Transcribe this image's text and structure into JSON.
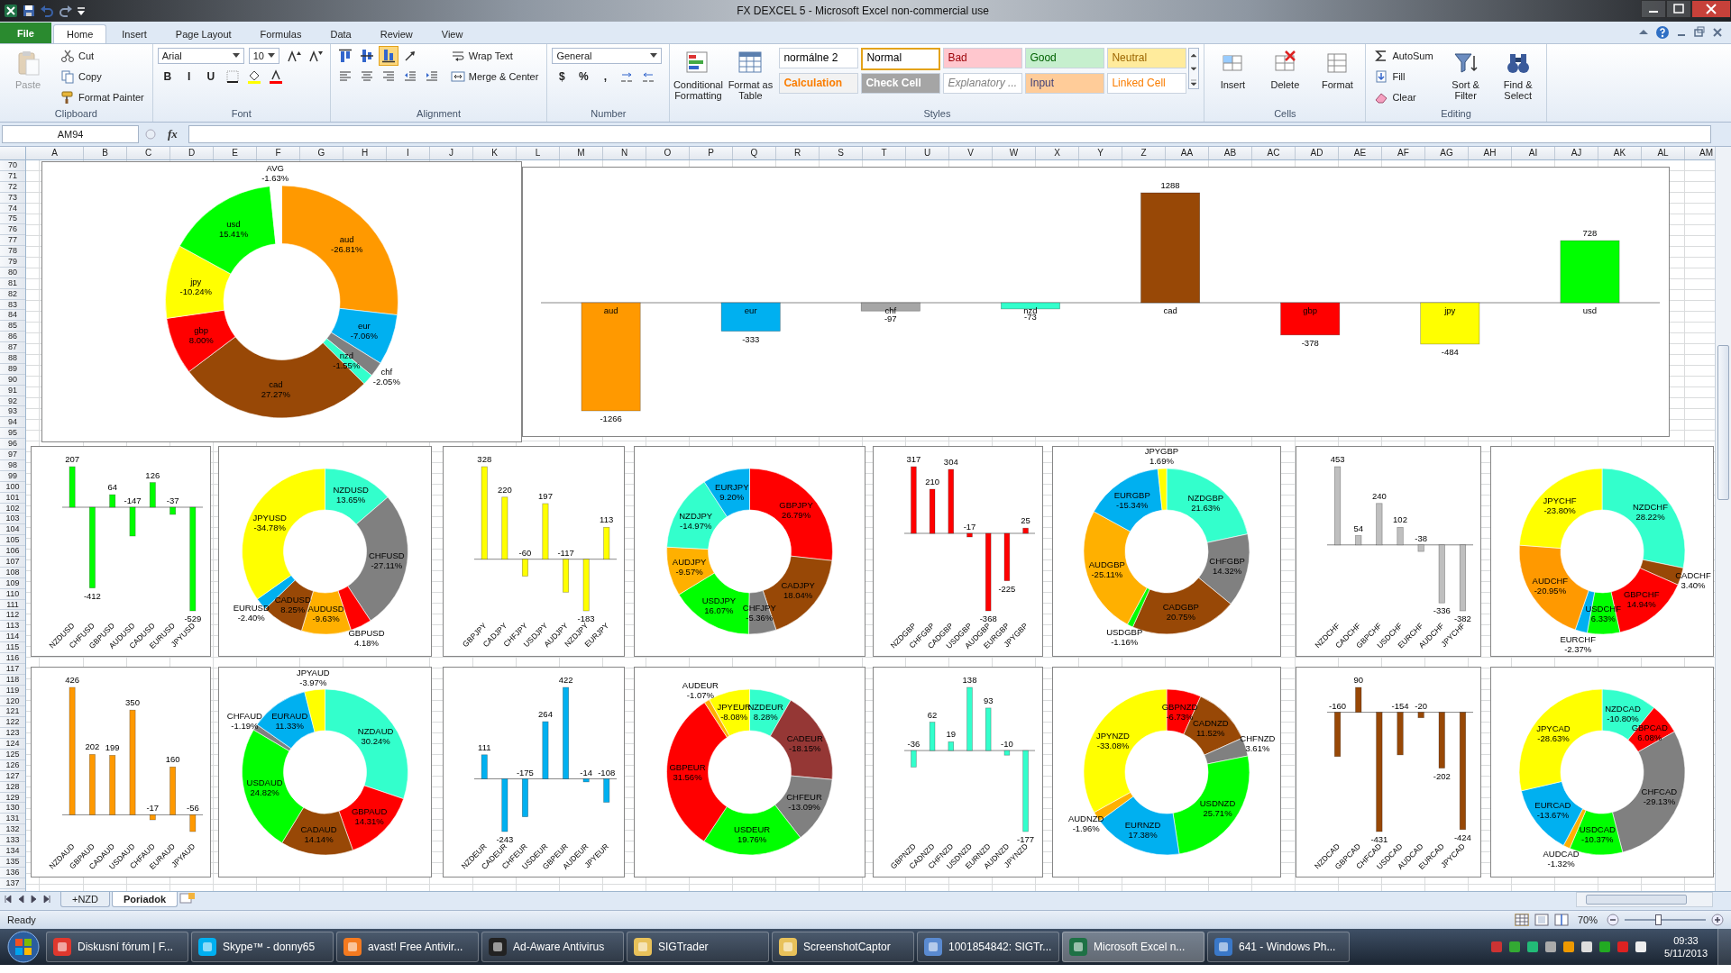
{
  "title_bar": {
    "title": "FX DEXCEL 5 - Microsoft Excel non-commercial use"
  },
  "ribbon_tabs": [
    {
      "label": "File",
      "kind": "file",
      "selected": false
    },
    {
      "label": "Home",
      "kind": "tab",
      "selected": true
    },
    {
      "label": "Insert",
      "kind": "tab",
      "selected": false
    },
    {
      "label": "Page Layout",
      "kind": "tab",
      "selected": false
    },
    {
      "label": "Formulas",
      "kind": "tab",
      "selected": false
    },
    {
      "label": "Data",
      "kind": "tab",
      "selected": false
    },
    {
      "label": "Review",
      "kind": "tab",
      "selected": false
    },
    {
      "label": "View",
      "kind": "tab",
      "selected": false
    }
  ],
  "ribbon": {
    "groups": [
      {
        "label": "Clipboard",
        "stacks": [
          [
            [
              {
                "kind": "large",
                "label": "Paste",
                "disabled": true
              }
            ]
          ],
          [
            [
              {
                "kind": "small",
                "label": "Cut",
                "disabled": false
              }
            ],
            [
              {
                "kind": "small",
                "label": "Copy",
                "disabled": false
              }
            ],
            [
              {
                "kind": "small",
                "label": "Format Painter",
                "disabled": false
              }
            ]
          ]
        ]
      },
      {
        "label": "Font",
        "stacks": [
          [
            [
              {
                "kind": "combo",
                "value": "Arial"
              },
              {
                "kind": "combo",
                "value": "10"
              },
              {
                "kind": "icon"
              },
              {
                "kind": "icon"
              }
            ],
            [
              {
                "kind": "text",
                "label": "B"
              },
              {
                "kind": "text",
                "label": "I"
              },
              {
                "kind": "text",
                "label": "U"
              },
              {
                "kind": "icon"
              },
              {
                "kind": "icon"
              },
              {
                "kind": "icon"
              }
            ]
          ]
        ]
      },
      {
        "label": "Alignment",
        "stacks": [
          [
            [
              {
                "kind": "icon",
                "selected": false
              },
              {
                "kind": "icon",
                "selected": false
              },
              {
                "kind": "icon",
                "selected": true
              },
              {
                "kind": "icon",
                "selected": false
              }
            ],
            [
              {
                "kind": "icon"
              },
              {
                "kind": "icon"
              },
              {
                "kind": "icon"
              },
              {
                "kind": "icon"
              },
              {
                "kind": "icon"
              }
            ]
          ],
          [
            [
              {
                "kind": "small",
                "label": "Wrap Text"
              }
            ],
            [
              {
                "kind": "small",
                "label": "Merge & Center"
              }
            ]
          ]
        ]
      },
      {
        "label": "Number",
        "stacks": [
          [
            [
              {
                "kind": "combo",
                "value": "General"
              }
            ],
            [
              {
                "kind": "text",
                "label": "$"
              },
              {
                "kind": "text",
                "label": "%"
              },
              {
                "kind": "text",
                "label": ","
              },
              {
                "kind": "icon"
              },
              {
                "kind": "icon"
              }
            ]
          ]
        ]
      },
      {
        "label": "Styles",
        "stacks": [
          [
            [
              {
                "kind": "large",
                "label": "Conditional Formatting"
              }
            ]
          ],
          [
            [
              {
                "kind": "large",
                "label": "Format as Table"
              }
            ]
          ],
          [
            [
              {
                "kind": "gallery",
                "styles": [
                  {
                    "label": "normálne 2",
                    "color": "#ffffff",
                    "kind": "normal",
                    "selected": false
                  },
                  {
                    "label": "Normal",
                    "color": "#ffffff",
                    "kind": "normal",
                    "selected": true
                  },
                  {
                    "label": "Bad",
                    "color": "#ffc7ce",
                    "kind": "bad",
                    "selected": false
                  },
                  {
                    "label": "Good",
                    "color": "#c6efce",
                    "kind": "good",
                    "selected": false
                  },
                  {
                    "label": "Neutral",
                    "color": "#ffeb9c",
                    "kind": "neutral",
                    "selected": false
                  },
                  {
                    "label": "Calculation",
                    "color": "#f2f2f2",
                    "kind": "calculation",
                    "selected": false
                  },
                  {
                    "label": "Check Cell",
                    "color": "#a5a5a5",
                    "kind": "check",
                    "selected": false
                  },
                  {
                    "label": "Explanatory ...",
                    "color": "#ffffff",
                    "kind": "explanatory",
                    "selected": false
                  },
                  {
                    "label": "Input",
                    "color": "#ffcc99",
                    "kind": "input",
                    "selected": false
                  },
                  {
                    "label": "Linked Cell",
                    "color": "#ffffff",
                    "kind": "linked",
                    "selected": false
                  }
                ]
              }
            ]
          ]
        ]
      },
      {
        "label": "Cells",
        "stacks": [
          [
            [
              {
                "kind": "large",
                "label": "Insert"
              }
            ]
          ],
          [
            [
              {
                "kind": "large",
                "label": "Delete"
              }
            ]
          ],
          [
            [
              {
                "kind": "large",
                "label": "Format"
              }
            ]
          ]
        ]
      },
      {
        "label": "Editing",
        "stacks": [
          [
            [
              {
                "kind": "small",
                "label": "AutoSum"
              }
            ],
            [
              {
                "kind": "small",
                "label": "Fill"
              }
            ],
            [
              {
                "kind": "small",
                "label": "Clear"
              }
            ]
          ],
          [
            [
              {
                "kind": "large",
                "label": "Sort & Filter"
              }
            ]
          ],
          [
            [
              {
                "kind": "large",
                "label": "Find & Select"
              }
            ]
          ]
        ]
      }
    ]
  },
  "formula_bar": {
    "name_box": "AM94",
    "function_label": "fx"
  },
  "sheet": {
    "columns": [
      "A",
      "B",
      "C",
      "D",
      "E",
      "F",
      "G",
      "H",
      "I",
      "J",
      "K",
      "L",
      "M",
      "N",
      "O",
      "P",
      "Q",
      "R",
      "S",
      "T",
      "U",
      "V",
      "W",
      "X",
      "Y",
      "Z",
      "AA",
      "AB",
      "AC",
      "AD",
      "AE",
      "AF",
      "AG",
      "AH",
      "AI",
      "AJ",
      "AK",
      "AL",
      "AM"
    ],
    "rows": [
      "70",
      "71",
      "72",
      "73",
      "74",
      "75",
      "76",
      "77",
      "78",
      "79",
      "80",
      "81",
      "82",
      "83",
      "84",
      "85",
      "86",
      "87",
      "88",
      "89",
      "90",
      "91",
      "92",
      "93",
      "94",
      "95",
      "96",
      "97",
      "98",
      "99",
      "100",
      "101",
      "102",
      "103",
      "104",
      "105",
      "106",
      "107",
      "108",
      "109",
      "110",
      "111",
      "112",
      "113",
      "114",
      "115",
      "116",
      "117",
      "118",
      "119",
      "120",
      "121",
      "122",
      "123",
      "124",
      "125",
      "126",
      "127",
      "128",
      "129",
      "130",
      "131",
      "132",
      "133",
      "134",
      "135",
      "136",
      "137"
    ]
  },
  "charts": [
    {
      "chart_data": {
        "type": "donut",
        "categories": [
          "aud",
          "eur",
          "chf",
          "nzd",
          "cad",
          "gbp",
          "jpy",
          "usd",
          "AVG"
        ],
        "series": [
          {
            "values": [
              26.81,
              7.06,
              2.05,
              1.55,
              27.27,
              8.0,
              10.24,
              15.41,
              1.63
            ],
            "colors": [
              "#ff9900",
              "#00b0f0",
              "#808080",
              "#33ffcc",
              "#984806",
              "#ff0000",
              "#ffff00",
              "#00ff00",
              "#ffffff"
            ]
          }
        ],
        "value_labels": [
          "-26.81%",
          "-7.06%",
          "-2.05%",
          "-1.55%",
          "27.27%",
          "8.00%",
          "-10.24%",
          "15.41%",
          "-1.63%"
        ]
      }
    },
    {
      "chart_data": {
        "type": "bar",
        "categories": [
          "aud",
          "eur",
          "chf",
          "nzd",
          "cad",
          "gbp",
          "jpy",
          "usd"
        ],
        "series": [
          {
            "values": [
              -1266,
              -333,
              -97,
              -73,
              1288,
              -378,
              -484,
              728
            ],
            "colors": [
              "#ff9900",
              "#00b0f0",
              "#a6a6a6",
              "#33ffcc",
              "#984806",
              "#ff0000",
              "#ffff00",
              "#00ff00"
            ]
          }
        ],
        "data_labels": true
      }
    },
    {
      "chart_data": {
        "type": "bar",
        "categories": [
          "NZDUSD",
          "CHFUSD",
          "GBPUSD",
          "AUDUSD",
          "CADUSD",
          "EURUSD",
          "JPYUSD"
        ],
        "series": [
          {
            "color": "#00ff00",
            "values": [
              207,
              -412,
              64,
              -147,
              126,
              -37,
              -529
            ]
          }
        ],
        "data_labels": true
      }
    },
    {
      "chart_data": {
        "type": "donut",
        "categories": [
          "NZDUSD",
          "CHFUSD",
          "GBPUSD",
          "AUDUSD",
          "CADUSD",
          "EURUSD",
          "JPYUSD"
        ],
        "series": [
          {
            "values": [
              13.65,
              27.11,
              4.18,
              9.63,
              8.25,
              2.4,
              34.78
            ],
            "colors": [
              "#33ffcc",
              "#808080",
              "#ff0000",
              "#ffb000",
              "#984806",
              "#00b0f0",
              "#ffff00"
            ]
          }
        ],
        "value_labels": [
          "13.65%",
          "-27.11%",
          "4.18%",
          "-9.63%",
          "8.25%",
          "-2.40%",
          "-34.78%"
        ]
      }
    },
    {
      "chart_data": {
        "type": "bar",
        "categories": [
          "GBPJPY",
          "CADJPY",
          "CHFJPY",
          "USDJPY",
          "AUDJPY",
          "NZDJPY",
          "EURJPY"
        ],
        "series": [
          {
            "color": "#ffff00",
            "values": [
              328,
              220,
              -60,
              197,
              -117,
              -183,
              113
            ]
          }
        ],
        "data_labels": true
      }
    },
    {
      "chart_data": {
        "type": "donut",
        "categories": [
          "GBPJPY",
          "CADJPY",
          "CHFJPY",
          "USDJPY",
          "AUDJPY",
          "NZDJPY",
          "EURJPY"
        ],
        "series": [
          {
            "values": [
              26.79,
              18.04,
              5.36,
              16.07,
              9.57,
              14.97,
              9.2
            ],
            "colors": [
              "#ff0000",
              "#984806",
              "#808080",
              "#00ff00",
              "#ffb000",
              "#33ffcc",
              "#00b0f0"
            ]
          }
        ],
        "value_labels": [
          "26.79%",
          "18.04%",
          "-5.36%",
          "16.07%",
          "-9.57%",
          "-14.97%",
          "9.20%"
        ]
      }
    },
    {
      "chart_data": {
        "type": "bar",
        "categories": [
          "NZDGBP",
          "CHFGBP",
          "CADGBP",
          "USDGBP",
          "AUDGBP",
          "EURGBP",
          "JPYGBP"
        ],
        "series": [
          {
            "color": "#ff0000",
            "values": [
              317,
              210,
              304,
              -17,
              -368,
              -225,
              25
            ]
          }
        ],
        "data_labels": true
      }
    },
    {
      "chart_data": {
        "type": "donut",
        "categories": [
          "NZDGBP",
          "CHFGBP",
          "CADGBP",
          "USDGBP",
          "AUDGBP",
          "EURGBP",
          "JPYGBP"
        ],
        "series": [
          {
            "values": [
              21.63,
              14.32,
              20.75,
              1.16,
              25.11,
              15.34,
              1.69
            ],
            "colors": [
              "#33ffcc",
              "#808080",
              "#984806",
              "#00ff00",
              "#ffb000",
              "#00b0f0",
              "#ffff00"
            ]
          }
        ],
        "value_labels": [
          "21.63%",
          "14.32%",
          "20.75%",
          "-1.16%",
          "-25.11%",
          "-15.34%",
          "1.69%"
        ]
      }
    },
    {
      "chart_data": {
        "type": "bar",
        "categories": [
          "NZDCHF",
          "CADCHF",
          "GBPCHF",
          "USDCHF",
          "EURCHF",
          "AUDCHF",
          "JPYCHF"
        ],
        "series": [
          {
            "color": "#bfbfbf",
            "values": [
              453,
              54,
              240,
              102,
              -38,
              -336,
              -382
            ]
          }
        ],
        "data_labels": true
      }
    },
    {
      "chart_data": {
        "type": "donut",
        "categories": [
          "NZDCHF",
          "CADCHF",
          "GBPCHF",
          "USDCHF",
          "EURCHF",
          "AUDCHF",
          "JPYCHF"
        ],
        "series": [
          {
            "values": [
              28.22,
              3.4,
              14.94,
              6.33,
              2.37,
              20.95,
              23.8
            ],
            "colors": [
              "#33ffcc",
              "#984806",
              "#ff0000",
              "#00ff00",
              "#00b0f0",
              "#ff9900",
              "#ffff00"
            ]
          }
        ],
        "value_labels": [
          "28.22%",
          "3.40%",
          "14.94%",
          "6.33%",
          "-2.37%",
          "-20.95%",
          "-23.80%"
        ]
      }
    },
    {
      "chart_data": {
        "type": "bar",
        "categories": [
          "NZDAUD",
          "GBPAUD",
          "CADAUD",
          "USDAUD",
          "CHFAUD",
          "EURAUD",
          "JPYAUD"
        ],
        "series": [
          {
            "color": "#ff9900",
            "values": [
              426,
              202,
              199,
              350,
              -17,
              160,
              -56
            ]
          }
        ],
        "data_labels": true
      }
    },
    {
      "chart_data": {
        "type": "donut",
        "categories": [
          "NZDAUD",
          "GBPAUD",
          "CADAUD",
          "USDAUD",
          "CHFAUD",
          "EURAUD",
          "JPYAUD"
        ],
        "series": [
          {
            "values": [
              30.24,
              14.31,
              14.14,
              24.82,
              1.19,
              11.33,
              3.97
            ],
            "colors": [
              "#33ffcc",
              "#ff0000",
              "#984806",
              "#00ff00",
              "#808080",
              "#00b0f0",
              "#ffff00"
            ]
          }
        ],
        "value_labels": [
          "30.24%",
          "14.31%",
          "14.14%",
          "24.82%",
          "-1.19%",
          "11.33%",
          "-3.97%"
        ]
      }
    },
    {
      "chart_data": {
        "type": "bar",
        "categories": [
          "NZDEUR",
          "CADEUR",
          "CHFEUR",
          "USDEUR",
          "GBPEUR",
          "AUDEUR",
          "JPYEUR"
        ],
        "series": [
          {
            "color": "#00b0f0",
            "values": [
              111,
              -243,
              -175,
              264,
              422,
              -14,
              -108
            ]
          }
        ],
        "data_labels": true
      }
    },
    {
      "chart_data": {
        "type": "donut",
        "categories": [
          "NZDEUR",
          "CADEUR",
          "CHFEUR",
          "USDEUR",
          "GBPEUR",
          "AUDEUR",
          "JPYEUR"
        ],
        "series": [
          {
            "values": [
              8.28,
              18.15,
              13.09,
              19.76,
              31.56,
              1.07,
              8.08
            ],
            "colors": [
              "#33ffcc",
              "#953735",
              "#808080",
              "#00ff00",
              "#ff0000",
              "#ffb000",
              "#ffff00"
            ]
          }
        ],
        "value_labels": [
          "8.28%",
          "-18.15%",
          "-13.09%",
          "19.76%",
          "31.56%",
          "-1.07%",
          "-8.08%"
        ]
      }
    },
    {
      "chart_data": {
        "type": "bar",
        "categories": [
          "GBPNZD",
          "CADNZD",
          "CHFNZD",
          "USDNZD",
          "EURNZD",
          "AUDNZD",
          "JPYNZD"
        ],
        "series": [
          {
            "color": "#33ffcc",
            "values": [
              -36,
              62,
              19,
              138,
              93,
              -10,
              -177
            ]
          }
        ],
        "data_labels": true
      }
    },
    {
      "chart_data": {
        "type": "donut",
        "categories": [
          "GBPNZD",
          "CADNZD",
          "CHFNZD",
          "USDNZD",
          "EURNZD",
          "AUDNZD",
          "JPYNZD"
        ],
        "series": [
          {
            "values": [
              6.73,
              11.52,
              3.61,
              25.71,
              17.38,
              1.96,
              33.08
            ],
            "colors": [
              "#ff0000",
              "#984806",
              "#808080",
              "#00ff00",
              "#00b0f0",
              "#ffb000",
              "#ffff00"
            ]
          }
        ],
        "value_labels": [
          "-6.73%",
          "11.52%",
          "3.61%",
          "25.71%",
          "17.38%",
          "-1.96%",
          "-33.08%"
        ]
      }
    },
    {
      "chart_data": {
        "type": "bar",
        "categories": [
          "NZDCAD",
          "GBPCAD",
          "CHFCAD",
          "USDCAD",
          "AUDCAD",
          "EURCAD",
          "JPYCAD"
        ],
        "series": [
          {
            "color": "#984806",
            "values": [
              -160,
              90,
              -431,
              -154,
              -20,
              -202,
              -424
            ]
          }
        ],
        "data_labels": true
      }
    },
    {
      "chart_data": {
        "type": "donut",
        "categories": [
          "NZDCAD",
          "GBPCAD",
          "CHFCAD",
          "USDCAD",
          "AUDCAD",
          "EURCAD",
          "JPYCAD"
        ],
        "series": [
          {
            "values": [
              10.8,
              6.08,
              29.13,
              10.37,
              1.32,
              13.67,
              28.63
            ],
            "colors": [
              "#33ffcc",
              "#ff0000",
              "#808080",
              "#00ff00",
              "#ffb000",
              "#00b0f0",
              "#ffff00"
            ]
          }
        ],
        "value_labels": [
          "-10.80%",
          "6.08%",
          "-29.13%",
          "-10.37%",
          "-1.32%",
          "-13.67%",
          "-28.63%"
        ]
      }
    }
  ],
  "sheet_tabs": [
    {
      "label": "+NZD",
      "selected": false
    },
    {
      "label": "Poriadok",
      "selected": true
    }
  ],
  "status_bar": {
    "status": "Ready",
    "zoom": "70%",
    "zoom_slider": {
      "level": 0.41
    }
  },
  "taskbar": {
    "items": [
      {
        "label": "Diskusní fórum | F...",
        "selected": false
      },
      {
        "label": "Skype™ - donny65",
        "selected": false
      },
      {
        "label": "avast! Free Antivir...",
        "selected": false
      },
      {
        "label": "Ad-Aware Antivirus",
        "selected": false
      },
      {
        "label": "SIGTrader",
        "selected": false
      },
      {
        "label": "ScreenshotCaptor",
        "selected": false
      },
      {
        "label": "1001854842: SIGTr...",
        "selected": false
      },
      {
        "label": "Microsoft Excel n...",
        "selected": true
      },
      {
        "label": "641 - Windows Ph...",
        "selected": false
      }
    ],
    "clock": {
      "time": "09:33",
      "date": "5/11/2013"
    }
  }
}
